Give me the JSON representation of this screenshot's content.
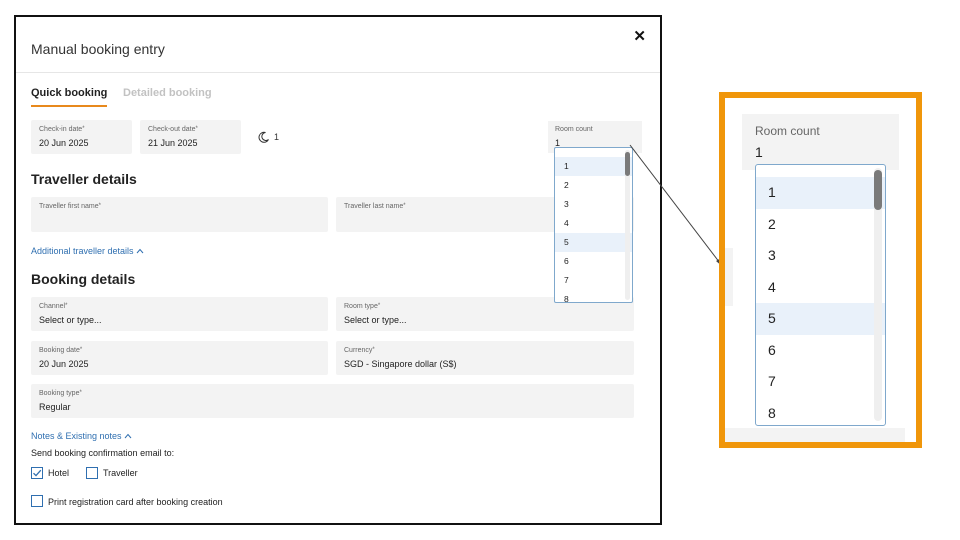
{
  "modal": {
    "title": "Manual booking entry",
    "tabs": [
      {
        "label": "Quick booking",
        "active": true
      },
      {
        "label": "Detailed booking",
        "active": false
      }
    ]
  },
  "stay": {
    "checkin_label": "Check-in date",
    "checkin_value": "20 Jun 2025",
    "checkout_label": "Check-out date",
    "checkout_value": "21 Jun 2025",
    "nights": "1",
    "room_count_label": "Room count",
    "room_count_value": "1"
  },
  "room_count_options": [
    "1",
    "2",
    "3",
    "4",
    "5",
    "6",
    "7",
    "8"
  ],
  "traveller": {
    "section_title": "Traveller details",
    "first_name_label": "Traveller first name",
    "last_name_label": "Traveller last name",
    "additional_link": "Additional traveller details"
  },
  "booking": {
    "section_title": "Booking details",
    "channel_label": "Channel",
    "channel_value": "Select or type...",
    "room_type_label": "Room type",
    "room_type_value": "Select or type...",
    "booking_date_label": "Booking date",
    "booking_date_value": "20 Jun 2025",
    "currency_label": "Currency",
    "currency_value": "SGD - Singapore dollar (S$)",
    "booking_type_label": "Booking type",
    "booking_type_value": "Regular"
  },
  "notes": {
    "link": "Notes & Existing notes",
    "email_prompt": "Send booking confirmation email to:",
    "hotel_label": "Hotel",
    "hotel_checked": true,
    "traveller_label": "Traveller",
    "traveller_checked": false,
    "print_label": "Print registration card after booking creation",
    "print_checked": false
  },
  "required_mark": "*",
  "zoom": {
    "label": "Room count",
    "value": "1"
  },
  "colors": {
    "accent_orange": "#f0960a",
    "tab_underline": "#e8891c",
    "link_blue": "#2f6fb0",
    "field_bg": "#f3f3f3",
    "highlight": "#e9f1fa"
  }
}
